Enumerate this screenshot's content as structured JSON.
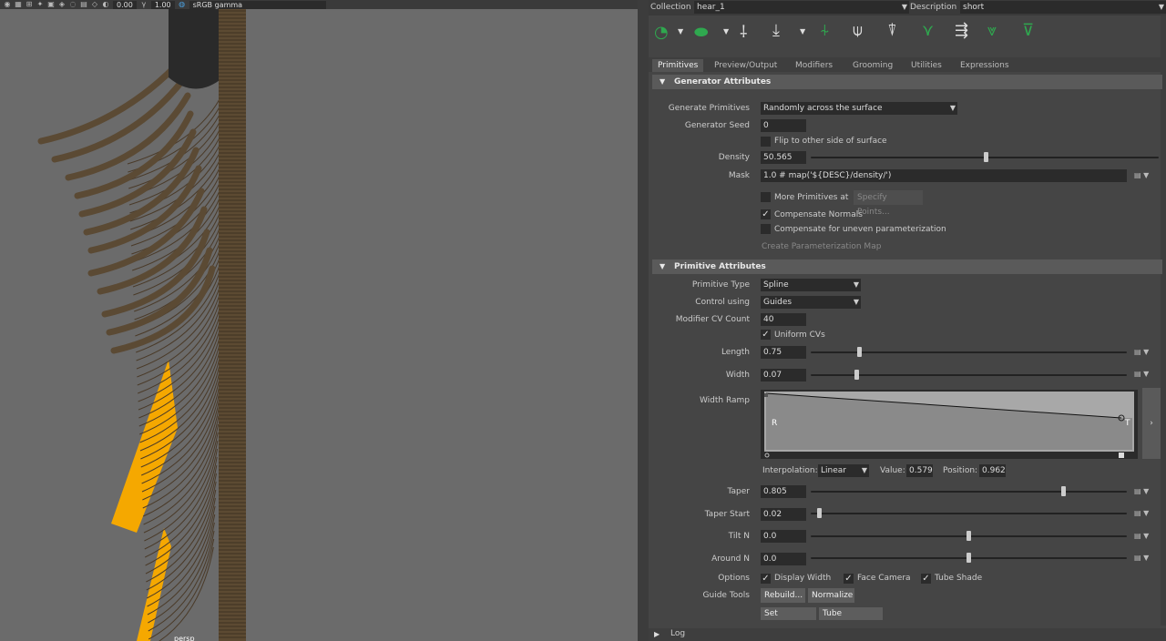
{
  "viewport": {
    "toolbar": {
      "field_a": "0.00",
      "field_b": "1.00",
      "color_space": "sRGB gamma"
    },
    "camera_label": "persp"
  },
  "header": {
    "collection_label": "Collection",
    "collection_value": "hear_1",
    "description_label": "Description",
    "description_value": "short"
  },
  "tabs": [
    "Primitives",
    "Preview/Output",
    "Modifiers",
    "Grooming",
    "Utilities",
    "Expressions"
  ],
  "generator": {
    "title": "Generator Attributes",
    "generate_label": "Generate Primitives",
    "generate_value": "Randomly across the surface",
    "seed_label": "Generator Seed",
    "seed_value": "0",
    "flip_label": "Flip to other side of surface",
    "density_label": "Density",
    "density_value": "50.565",
    "density_fraction": 0.505,
    "mask_label": "Mask",
    "mask_value": "1.0 # map('${DESC}/density/')",
    "more_label": "More Primitives at",
    "specify_label": "Specify Points...",
    "compensate_label": "Compensate Normals",
    "uneven_label": "Compensate for uneven parameterization",
    "create_map_label": "Create Parameterization Map"
  },
  "primitive": {
    "title": "Primitive Attributes",
    "type_label": "Primitive Type",
    "type_value": "Spline",
    "control_label": "Control using",
    "control_value": "Guides",
    "cv_label": "Modifier CV Count",
    "cv_value": "40",
    "uniform_label": "Uniform CVs",
    "length_label": "Length",
    "length_value": "0.75",
    "length_fraction": 0.15,
    "width_label": "Width",
    "width_value": "0.07",
    "width_fraction": 0.14,
    "ramp_label": "Width Ramp",
    "ramp_r": "R",
    "ramp_t": "T",
    "interp_label": "Interpolation:",
    "interp_value": "Linear",
    "value_label": "Value:",
    "value_value": "0.579",
    "position_label": "Position:",
    "position_value": "0.962",
    "taper_label": "Taper",
    "taper_value": "0.805",
    "taper_fraction": 0.805,
    "taper_start_label": "Taper Start",
    "taper_start_value": "0.02",
    "taper_start_fraction": 0.02,
    "tilt_label": "Tilt N",
    "tilt_value": "0.0",
    "tilt_fraction": 0.5,
    "around_label": "Around N",
    "around_value": "0.0",
    "around_fraction": 0.5,
    "options_label": "Options",
    "display_width_label": "Display Width",
    "face_camera_label": "Face Camera",
    "tube_shade_label": "Tube Shade",
    "guide_tools_label": "Guide Tools",
    "rebuild_label": "Rebuild...",
    "normalize_label": "Normalize",
    "set_length_label": "Set Length...",
    "tube_groom_label": "Tube Groom..."
  },
  "log": {
    "label": "Log"
  },
  "colors": {
    "hair": "#5b4a34",
    "highlight": "#f5a800",
    "panel": "#454545",
    "viewport": "#6b6b6b"
  }
}
